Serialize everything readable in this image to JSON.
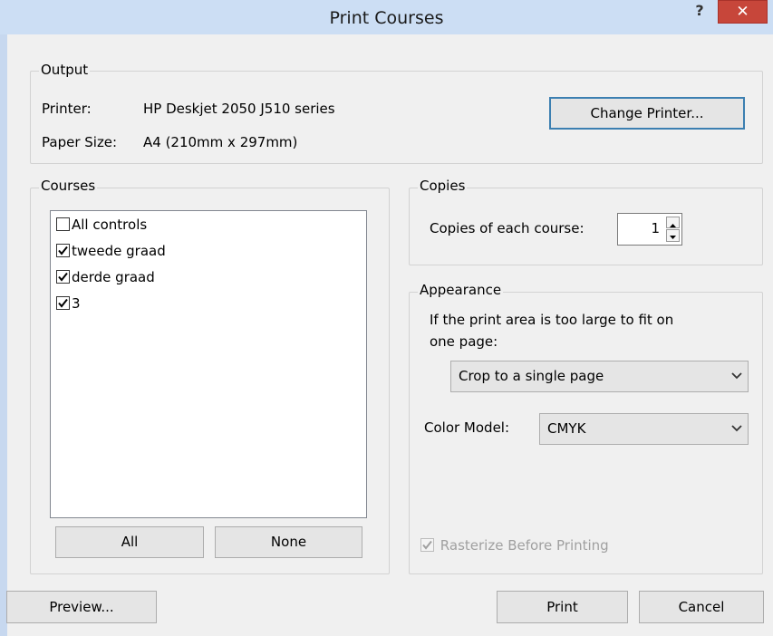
{
  "window": {
    "title": "Print Courses",
    "help": "?",
    "close": "✕"
  },
  "output": {
    "legend": "Output",
    "printer_label": "Printer:",
    "printer_value": "HP Deskjet 2050 J510 series",
    "paper_label": "Paper Size:",
    "paper_value": "A4 (210mm x 297mm)",
    "change_printer": "Change Printer..."
  },
  "courses": {
    "legend": "Courses",
    "items": [
      {
        "label": "All controls",
        "checked": false
      },
      {
        "label": "tweede graad",
        "checked": true
      },
      {
        "label": "derde graad",
        "checked": true
      },
      {
        "label": "3",
        "checked": true
      }
    ],
    "all_button": "All",
    "none_button": "None"
  },
  "copies": {
    "legend": "Copies",
    "label": "Copies of each course:",
    "value": "1"
  },
  "appearance": {
    "legend": "Appearance",
    "text_line1": "If the print area is too large to fit on",
    "text_line2": "one page:",
    "crop_selected": "Crop to a single page",
    "color_label": "Color Model:",
    "color_selected": "CMYK",
    "rasterize_label": "Rasterize Before Printing",
    "rasterize_checked": true
  },
  "buttons": {
    "preview": "Preview...",
    "print": "Print",
    "cancel": "Cancel"
  }
}
